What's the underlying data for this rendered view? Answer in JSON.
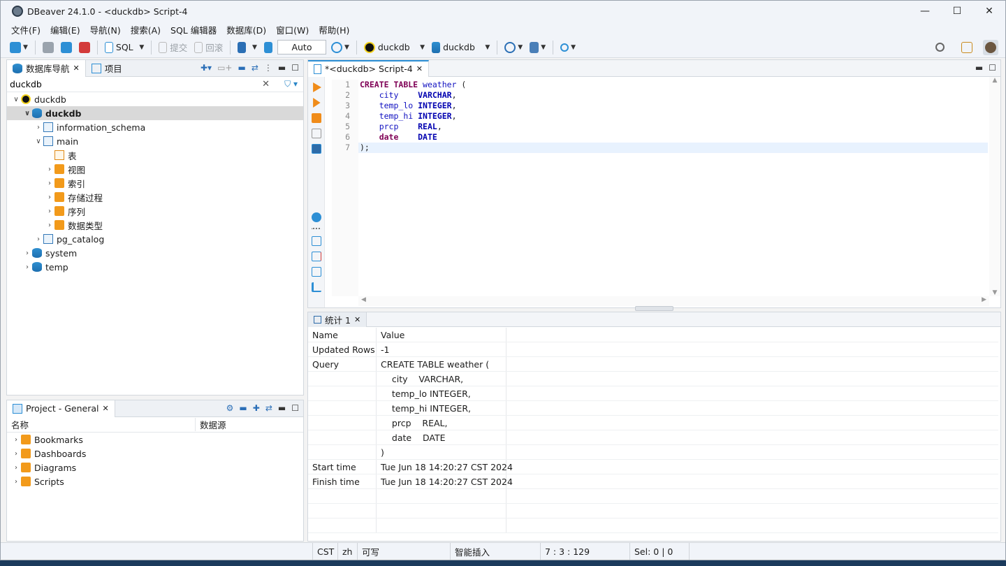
{
  "window": {
    "title": "DBeaver 24.1.0 - <duckdb> Script-4",
    "min": "—",
    "max": "☐",
    "close": "✕"
  },
  "menu": [
    "文件(F)",
    "编辑(E)",
    "导航(N)",
    "搜索(A)",
    "SQL 编辑器",
    "数据库(D)",
    "窗口(W)",
    "帮助(H)"
  ],
  "toolbar": {
    "sql_label": "SQL",
    "commit": "提交",
    "rollback": "回滚",
    "mode": "Auto",
    "datasource": "duckdb",
    "database": "duckdb"
  },
  "navigator": {
    "tab_label": "数据库导航",
    "projects_tab_label": "项目",
    "filter_value": "duckdb",
    "tree": [
      {
        "label": "duckdb",
        "depth": 0,
        "chevron": "∨",
        "icon": "duck-icon"
      },
      {
        "label": "duckdb",
        "depth": 1,
        "chevron": "∨",
        "icon": "database-icon",
        "selected": true
      },
      {
        "label": "information_schema",
        "depth": 2,
        "chevron": "›",
        "icon": "schema-icon"
      },
      {
        "label": "main",
        "depth": 2,
        "chevron": "∨",
        "icon": "schema-icon"
      },
      {
        "label": "表",
        "depth": 3,
        "chevron": "",
        "icon": "table-folder-icon"
      },
      {
        "label": "视图",
        "depth": 3,
        "chevron": "›",
        "icon": "view-folder-icon"
      },
      {
        "label": "索引",
        "depth": 3,
        "chevron": "›",
        "icon": "folder-icon"
      },
      {
        "label": "存储过程",
        "depth": 3,
        "chevron": "›",
        "icon": "folder-icon"
      },
      {
        "label": "序列",
        "depth": 3,
        "chevron": "›",
        "icon": "folder-icon"
      },
      {
        "label": "数据类型",
        "depth": 3,
        "chevron": "›",
        "icon": "folder-icon"
      },
      {
        "label": "pg_catalog",
        "depth": 2,
        "chevron": "›",
        "icon": "schema-icon"
      },
      {
        "label": "system",
        "depth": 1,
        "chevron": "›",
        "icon": "database-icon"
      },
      {
        "label": "temp",
        "depth": 1,
        "chevron": "›",
        "icon": "database-icon"
      }
    ]
  },
  "project": {
    "tab_label": "Project - General",
    "col_name": "名称",
    "col_datasource": "数据源",
    "items": [
      "Bookmarks",
      "Dashboards",
      "Diagrams",
      "Scripts"
    ]
  },
  "editor": {
    "tab_label": "*<duckdb> Script-4",
    "lines": [
      {
        "n": "1",
        "parts": [
          [
            "kw",
            "CREATE "
          ],
          [
            "kw",
            "TABLE "
          ],
          [
            "id",
            "weather"
          ],
          [
            "p",
            " ("
          ]
        ]
      },
      {
        "n": "2",
        "parts": [
          [
            "p",
            "    "
          ],
          [
            "id",
            "city"
          ],
          [
            "p",
            "    "
          ],
          [
            "tp",
            "VARCHAR"
          ],
          [
            "p",
            ","
          ]
        ]
      },
      {
        "n": "3",
        "parts": [
          [
            "p",
            "    "
          ],
          [
            "id",
            "temp_lo"
          ],
          [
            "p",
            " "
          ],
          [
            "tp",
            "INTEGER"
          ],
          [
            "p",
            ","
          ]
        ]
      },
      {
        "n": "4",
        "parts": [
          [
            "p",
            "    "
          ],
          [
            "id",
            "temp_hi"
          ],
          [
            "p",
            " "
          ],
          [
            "tp",
            "INTEGER"
          ],
          [
            "p",
            ","
          ]
        ]
      },
      {
        "n": "5",
        "parts": [
          [
            "p",
            "    "
          ],
          [
            "id",
            "prcp"
          ],
          [
            "p",
            "    "
          ],
          [
            "tp",
            "REAL"
          ],
          [
            "p",
            ","
          ]
        ]
      },
      {
        "n": "6",
        "parts": [
          [
            "p",
            "    "
          ],
          [
            "dk",
            "date"
          ],
          [
            "p",
            "    "
          ],
          [
            "tp",
            "DATE"
          ]
        ]
      },
      {
        "n": "7",
        "parts": [
          [
            "p",
            ");"
          ]
        ]
      }
    ]
  },
  "results": {
    "tab_label": "统计 1",
    "rows": [
      [
        "Name",
        "Value"
      ],
      [
        "Updated Rows",
        "-1"
      ],
      [
        "Query",
        "CREATE TABLE weather ("
      ],
      [
        "",
        "    city    VARCHAR,"
      ],
      [
        "",
        "    temp_lo INTEGER,"
      ],
      [
        "",
        "    temp_hi INTEGER,"
      ],
      [
        "",
        "    prcp    REAL,"
      ],
      [
        "",
        "    date    DATE"
      ],
      [
        "",
        ")"
      ],
      [
        "Start time",
        "Tue Jun 18 14:20:27 CST 2024"
      ],
      [
        "Finish time",
        "Tue Jun 18 14:20:27 CST 2024"
      ],
      [
        "",
        ""
      ],
      [
        "",
        ""
      ],
      [
        "",
        ""
      ]
    ]
  },
  "status": {
    "tz": "CST",
    "lang": "zh",
    "rw": "可写",
    "insert": "智能插入",
    "pos": "7 : 3 : 129",
    "sel": "Sel: 0 | 0"
  }
}
